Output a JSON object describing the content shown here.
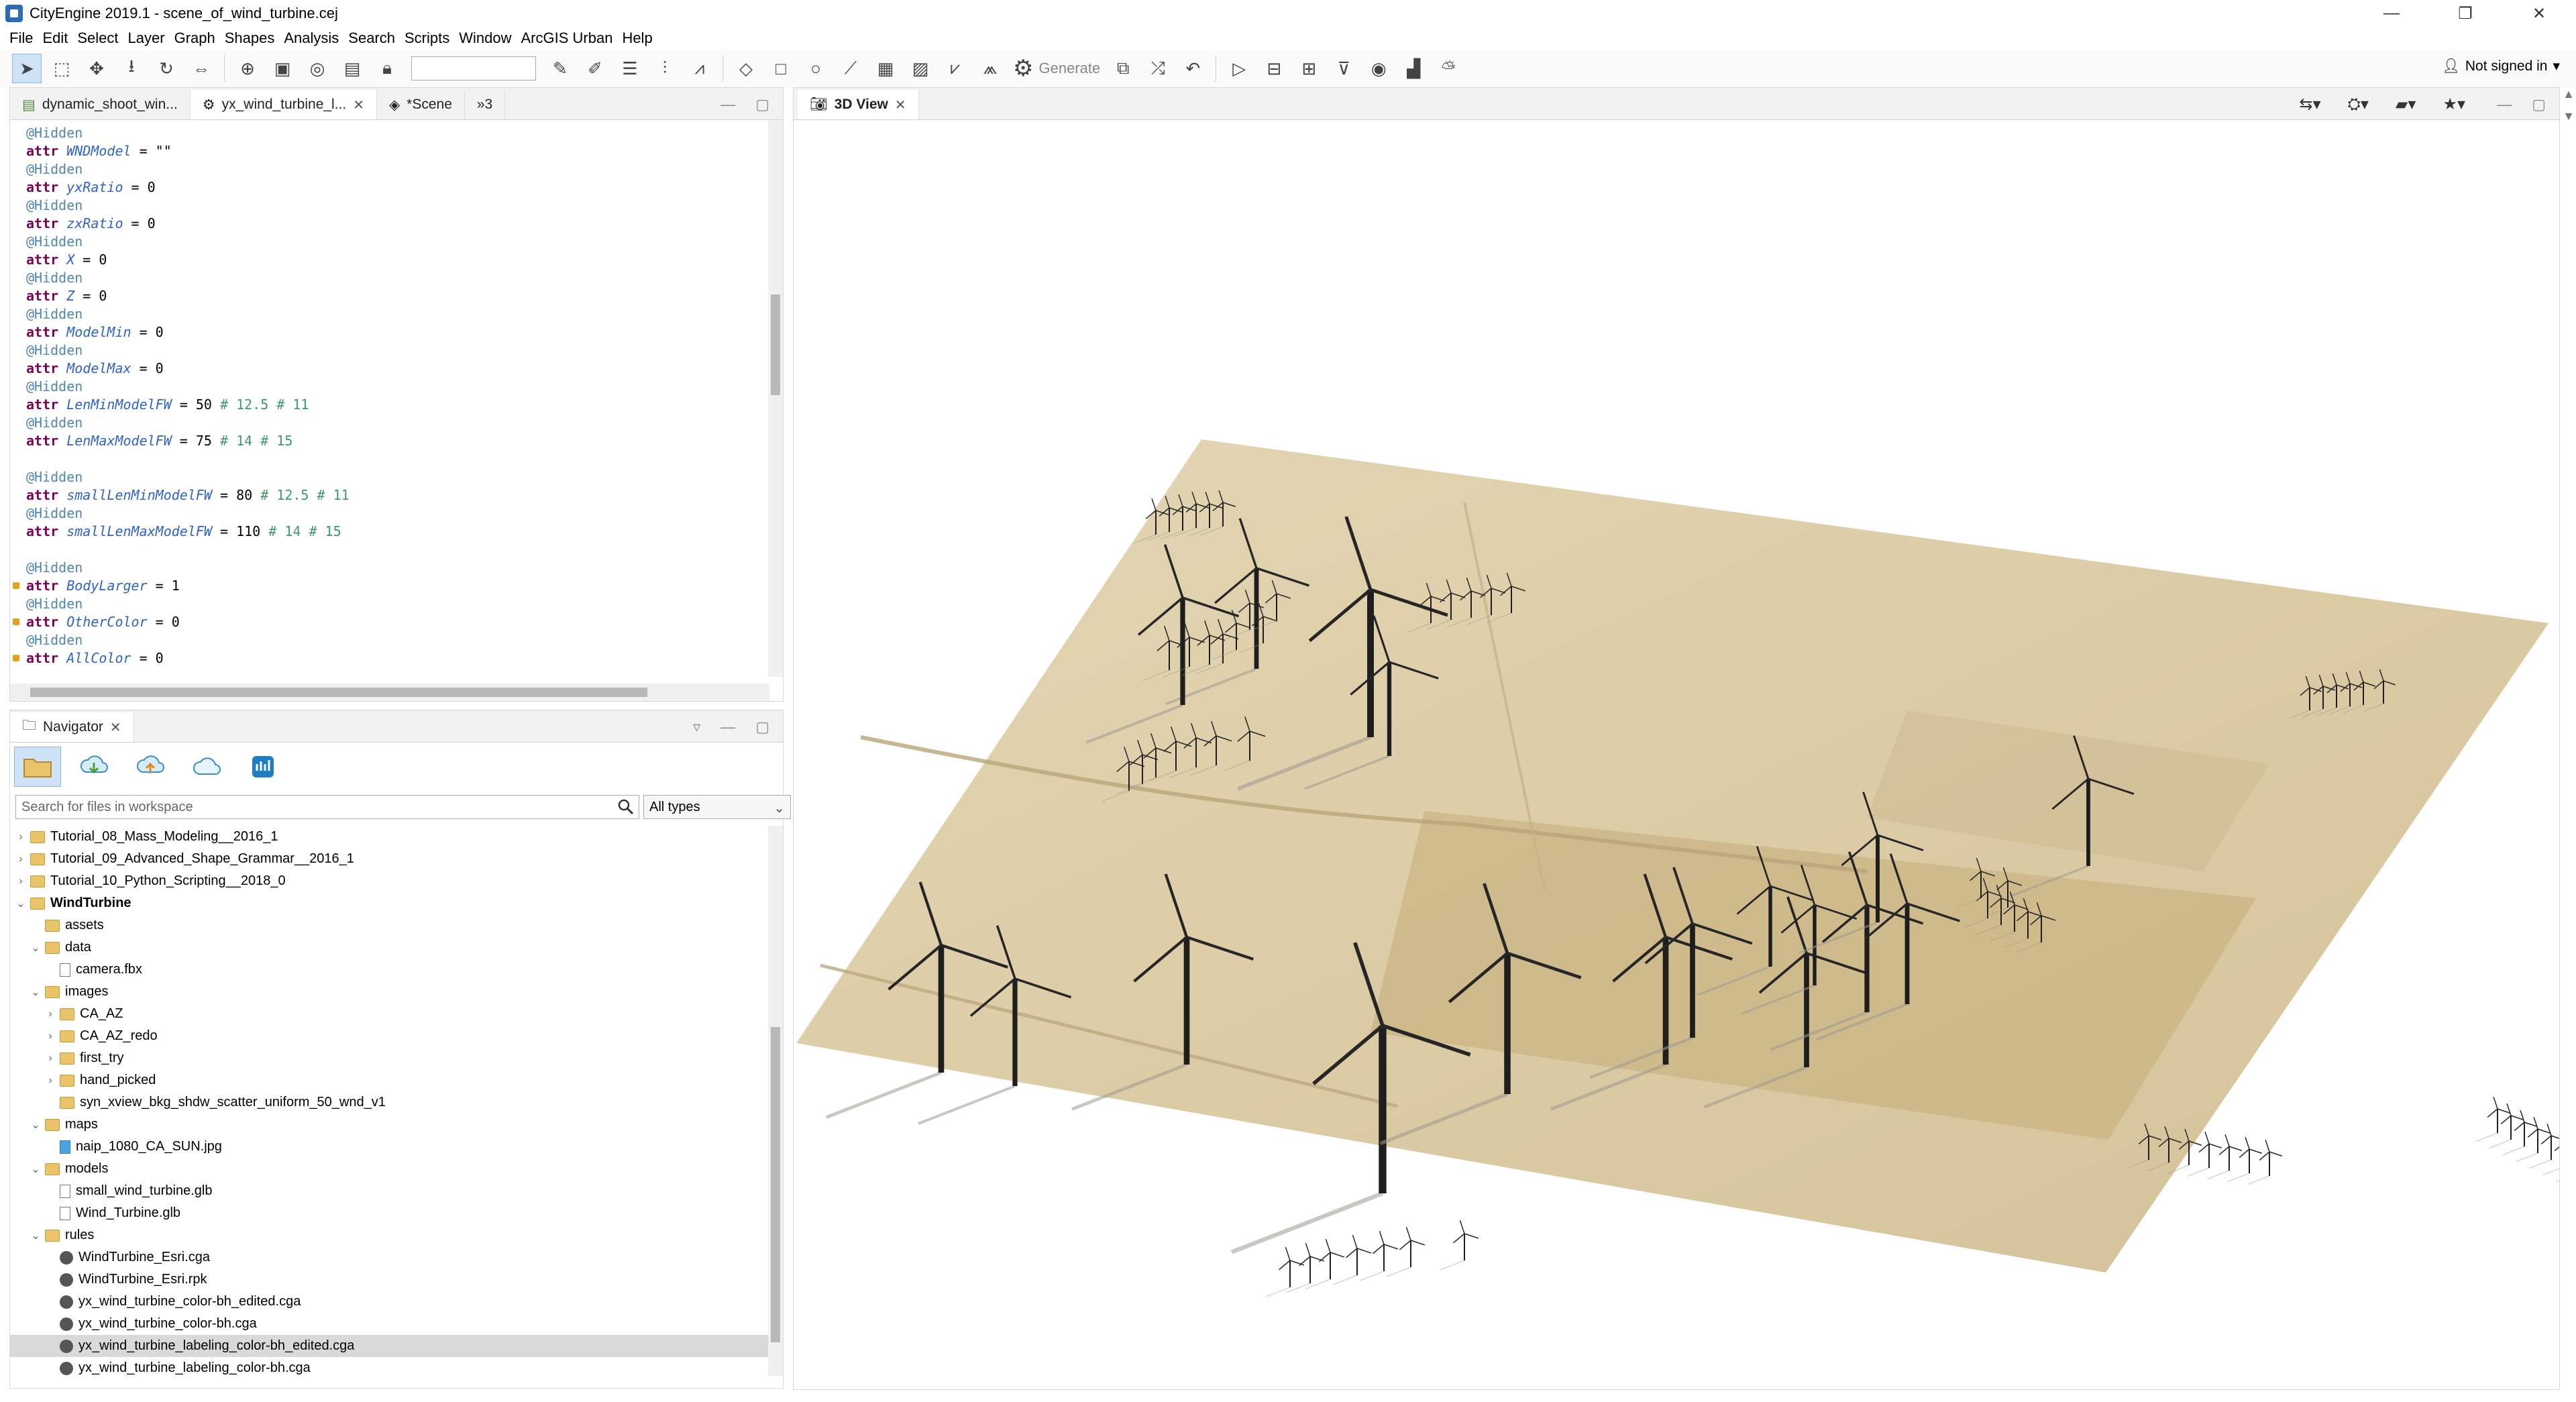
{
  "window": {
    "title": "CityEngine 2019.1 - scene_of_wind_turbine.cej",
    "controls": [
      "—",
      "❐",
      "✕"
    ]
  },
  "menu": [
    "File",
    "Edit",
    "Select",
    "Layer",
    "Graph",
    "Shapes",
    "Analysis",
    "Search",
    "Scripts",
    "Window",
    "ArcGIS Urban",
    "Help"
  ],
  "toolbar": {
    "generate_label": "Generate",
    "search_value": ""
  },
  "account": {
    "status": "Not signed in"
  },
  "editor": {
    "tabs": [
      {
        "label": "dynamic_shoot_win..."
      },
      {
        "label": "yx_wind_turbine_l..."
      },
      {
        "label": "*Scene"
      },
      {
        "label": "»3"
      }
    ],
    "lines": [
      {
        "ann": "@Hidden"
      },
      {
        "kw": "attr",
        "var": "WNDModel",
        "rest": " = \"\""
      },
      {
        "ann": "@Hidden"
      },
      {
        "kw": "attr",
        "var": "yxRatio",
        "rest": " = 0"
      },
      {
        "ann": "@Hidden"
      },
      {
        "kw": "attr",
        "var": "zxRatio",
        "rest": " = 0"
      },
      {
        "ann": "@Hidden"
      },
      {
        "kw": "attr",
        "var": "X",
        "rest": " = 0"
      },
      {
        "ann": "@Hidden"
      },
      {
        "kw": "attr",
        "var": "Z",
        "rest": " = 0"
      },
      {
        "ann": "@Hidden"
      },
      {
        "kw": "attr",
        "var": "ModelMin",
        "rest": " = 0"
      },
      {
        "ann": "@Hidden"
      },
      {
        "kw": "attr",
        "var": "ModelMax",
        "rest": " = 0"
      },
      {
        "ann": "@Hidden"
      },
      {
        "kw": "attr",
        "var": "LenMinModelFW",
        "rest": " = 50 ",
        "cmt": "# 12.5 # 11"
      },
      {
        "ann": "@Hidden"
      },
      {
        "kw": "attr",
        "var": "LenMaxModelFW",
        "rest": " = 75 ",
        "cmt": "# 14 # 15"
      },
      {
        "blank": true
      },
      {
        "ann": "@Hidden"
      },
      {
        "kw": "attr",
        "var": "smallLenMinModelFW",
        "rest": " = 80 ",
        "cmt": "# 12.5 # 11"
      },
      {
        "ann": "@Hidden"
      },
      {
        "kw": "attr",
        "var": "smallLenMaxModelFW",
        "rest": " = 110 ",
        "cmt": "# 14 # 15"
      },
      {
        "blank": true
      },
      {
        "ann": "@Hidden"
      },
      {
        "kw": "attr",
        "var": "BodyLarger",
        "rest": " = 1",
        "warn": true
      },
      {
        "ann": "@Hidden"
      },
      {
        "kw": "attr",
        "var": "OtherColor",
        "rest": " = 0",
        "warn": true
      },
      {
        "ann": "@Hidden"
      },
      {
        "kw": "attr",
        "var": "AllColor",
        "rest": " = 0",
        "warn": true
      }
    ]
  },
  "navigator": {
    "tab_label": "Navigator",
    "search_placeholder": "Search for files in workspace",
    "type_filter": "All types",
    "tree": [
      {
        "label": "Tutorial_08_Mass_Modeling__2016_1",
        "depth": 0,
        "twisty": "›",
        "icon": "folder"
      },
      {
        "label": "Tutorial_09_Advanced_Shape_Grammar__2016_1",
        "depth": 0,
        "twisty": "›",
        "icon": "folder"
      },
      {
        "label": "Tutorial_10_Python_Scripting__2018_0",
        "depth": 0,
        "twisty": "›",
        "icon": "folder"
      },
      {
        "label": "WindTurbine",
        "depth": 0,
        "twisty": "⌄",
        "icon": "folder",
        "bold": true
      },
      {
        "label": "assets",
        "depth": 1,
        "twisty": "",
        "icon": "folder"
      },
      {
        "label": "data",
        "depth": 1,
        "twisty": "⌄",
        "icon": "folder"
      },
      {
        "label": "camera.fbx",
        "depth": 2,
        "twisty": "",
        "icon": "file"
      },
      {
        "label": "images",
        "depth": 1,
        "twisty": "⌄",
        "icon": "folder"
      },
      {
        "label": "CA_AZ",
        "depth": 2,
        "twisty": "›",
        "icon": "folder"
      },
      {
        "label": "CA_AZ_redo",
        "depth": 2,
        "twisty": "›",
        "icon": "folder"
      },
      {
        "label": "first_try",
        "depth": 2,
        "twisty": "›",
        "icon": "folder"
      },
      {
        "label": "hand_picked",
        "depth": 2,
        "twisty": "›",
        "icon": "folder"
      },
      {
        "label": "syn_xview_bkg_shdw_scatter_uniform_50_wnd_v1",
        "depth": 2,
        "twisty": "",
        "icon": "folder"
      },
      {
        "label": "maps",
        "depth": 1,
        "twisty": "⌄",
        "icon": "folder"
      },
      {
        "label": "naip_1080_CA_SUN.jpg",
        "depth": 2,
        "twisty": "",
        "icon": "img"
      },
      {
        "label": "models",
        "depth": 1,
        "twisty": "⌄",
        "icon": "folder"
      },
      {
        "label": "small_wind_turbine.glb",
        "depth": 2,
        "twisty": "",
        "icon": "file"
      },
      {
        "label": "Wind_Turbine.glb",
        "depth": 2,
        "twisty": "",
        "icon": "file"
      },
      {
        "label": "rules",
        "depth": 1,
        "twisty": "⌄",
        "icon": "folder"
      },
      {
        "label": "WindTurbine_Esri.cga",
        "depth": 2,
        "twisty": "",
        "icon": "gear"
      },
      {
        "label": "WindTurbine_Esri.rpk",
        "depth": 2,
        "twisty": "",
        "icon": "gear"
      },
      {
        "label": "yx_wind_turbine_color-bh_edited.cga",
        "depth": 2,
        "twisty": "",
        "icon": "gear"
      },
      {
        "label": "yx_wind_turbine_color-bh.cga",
        "depth": 2,
        "twisty": "",
        "icon": "gear"
      },
      {
        "label": "yx_wind_turbine_labeling_color-bh_edited.cga",
        "depth": 2,
        "twisty": "",
        "icon": "gear",
        "selected": true
      },
      {
        "label": "yx_wind_turbine_labeling_color-bh.cga",
        "depth": 2,
        "twisty": "",
        "icon": "gear"
      }
    ]
  },
  "view3d": {
    "tab_label": "3D View",
    "terrain_color": "#d9c9a3",
    "terrain_dark": "#c4ad7e"
  }
}
